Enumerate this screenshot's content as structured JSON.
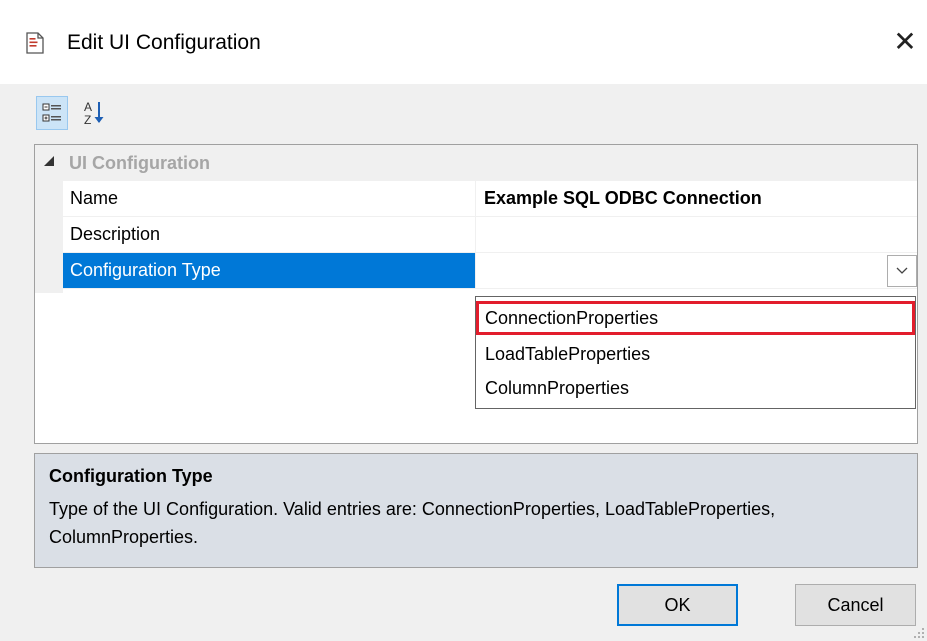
{
  "window": {
    "title": "Edit UI Configuration",
    "close_glyph": "✕"
  },
  "toolbar": {
    "categorized_icon": "categorized-view-icon",
    "alphabetical_icon": "sort-alphabetical-icon"
  },
  "grid": {
    "category": "UI Configuration",
    "rows": [
      {
        "name": "Name",
        "value": "Example SQL ODBC Connection"
      },
      {
        "name": "Description",
        "value": ""
      },
      {
        "name": "Configuration Type",
        "value": ""
      }
    ]
  },
  "dropdown": {
    "options": [
      "ConnectionProperties",
      "LoadTableProperties",
      "ColumnProperties"
    ],
    "highlighted": "ConnectionProperties"
  },
  "help": {
    "title": "Configuration Type",
    "description": "Type of the UI Configuration. Valid entries are: ConnectionProperties, LoadTableProperties, ColumnProperties."
  },
  "buttons": {
    "ok": "OK",
    "cancel": "Cancel"
  },
  "colors": {
    "selection": "#0078d7",
    "highlight_border": "#e21d2c",
    "help_background": "#dadfe6"
  }
}
